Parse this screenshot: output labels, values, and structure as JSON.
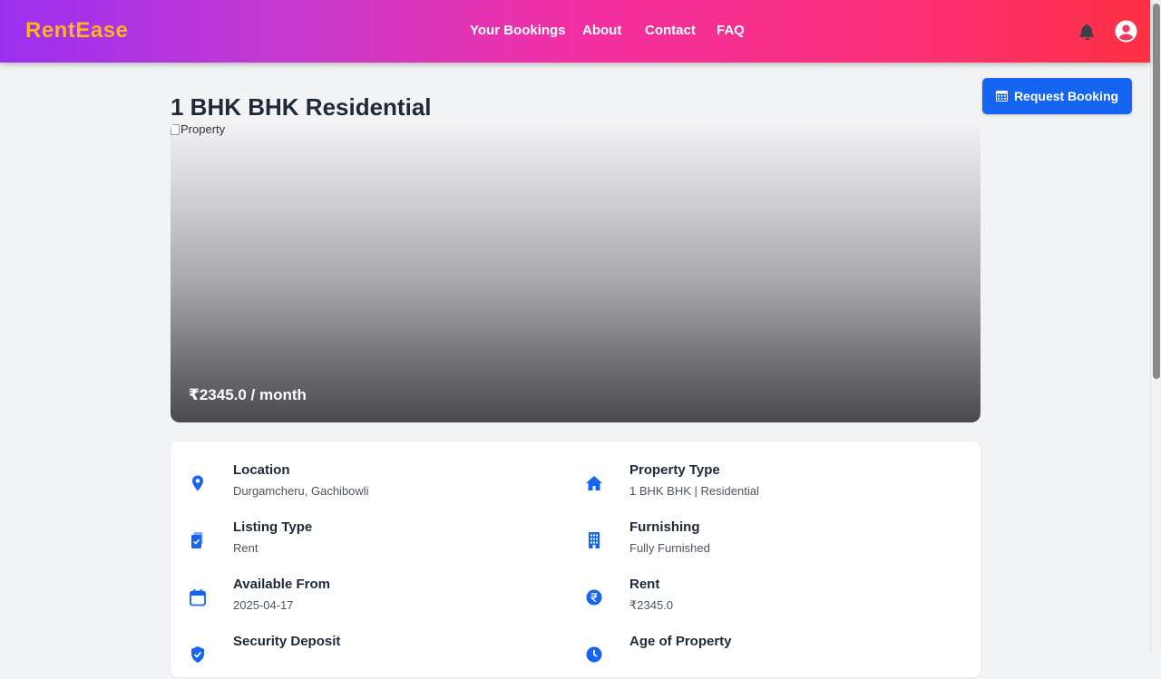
{
  "header": {
    "brand": "RentEase",
    "nav": [
      "Your Bookings",
      "About",
      "Contact",
      "FAQ"
    ]
  },
  "property": {
    "title": "1 BHK BHK Residential",
    "image_alt": "Property",
    "price_text": "₹2345.0 / month",
    "request_button": "Request Booking"
  },
  "details": [
    {
      "label": "Location",
      "value": "Durgamcheru, Gachibowli",
      "icon": "location-pin-icon"
    },
    {
      "label": "Property Type",
      "value": "1 BHK BHK | Residential",
      "icon": "home-icon"
    },
    {
      "label": "Listing Type",
      "value": "Rent",
      "icon": "clipboard-check-icon"
    },
    {
      "label": "Furnishing",
      "value": "Fully Furnished",
      "icon": "building-icon"
    },
    {
      "label": "Available From",
      "value": "2025-04-17",
      "icon": "calendar-icon"
    },
    {
      "label": "Rent",
      "value": "₹2345.0",
      "icon": "rupee-icon"
    },
    {
      "label": "Security Deposit",
      "value": "",
      "icon": "shield-check-icon"
    },
    {
      "label": "Age of Property",
      "value": "",
      "icon": "clock-icon"
    }
  ],
  "colors": {
    "accent": "#1565f2",
    "brand": "#ffb21e",
    "header_gradient": [
      "#9b2ff0",
      "#f22fa3",
      "#fd3042"
    ]
  }
}
